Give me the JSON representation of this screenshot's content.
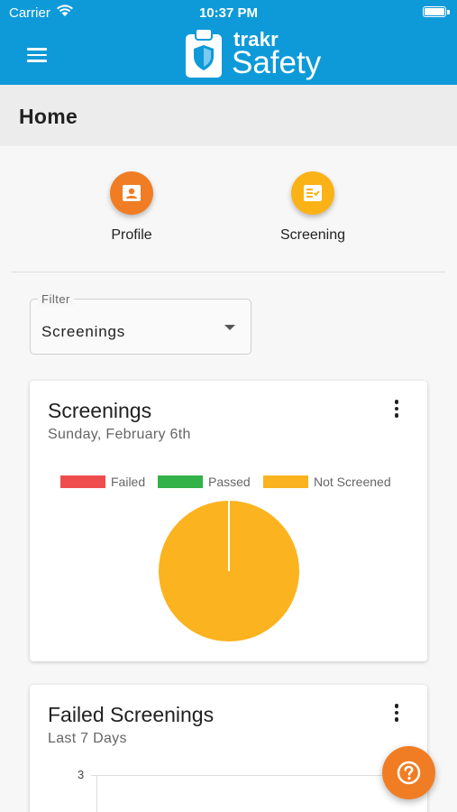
{
  "status_bar": {
    "carrier": "Carrier",
    "time": "10:37 PM"
  },
  "app": {
    "brand": "trakr",
    "product": "Safety"
  },
  "page": {
    "title": "Home"
  },
  "quick_actions": [
    {
      "label": "Profile",
      "icon": "profile-icon",
      "color": "#f07d23"
    },
    {
      "label": "Screening",
      "icon": "screening-icon",
      "color": "#fbb216"
    }
  ],
  "filter": {
    "label": "Filter",
    "value": "Screenings"
  },
  "cards": [
    {
      "title": "Screenings",
      "subtitle": "Sunday, February 6th",
      "chart_data": {
        "type": "pie",
        "legend": [
          {
            "name": "Failed",
            "color": "#ef4d4d"
          },
          {
            "name": "Passed",
            "color": "#33b249"
          },
          {
            "name": "Not Screened",
            "color": "#fbb31f"
          }
        ],
        "values": [
          0,
          0,
          100
        ],
        "legend_position": "top"
      }
    },
    {
      "title": "Failed Screenings",
      "subtitle": "Last 7 Days",
      "chart_data": {
        "type": "line",
        "y_ticks": [
          "3"
        ]
      }
    }
  ],
  "fab": {
    "icon": "help-icon"
  },
  "colors": {
    "primary": "#0e9ad8",
    "accent": "#f07d23"
  }
}
